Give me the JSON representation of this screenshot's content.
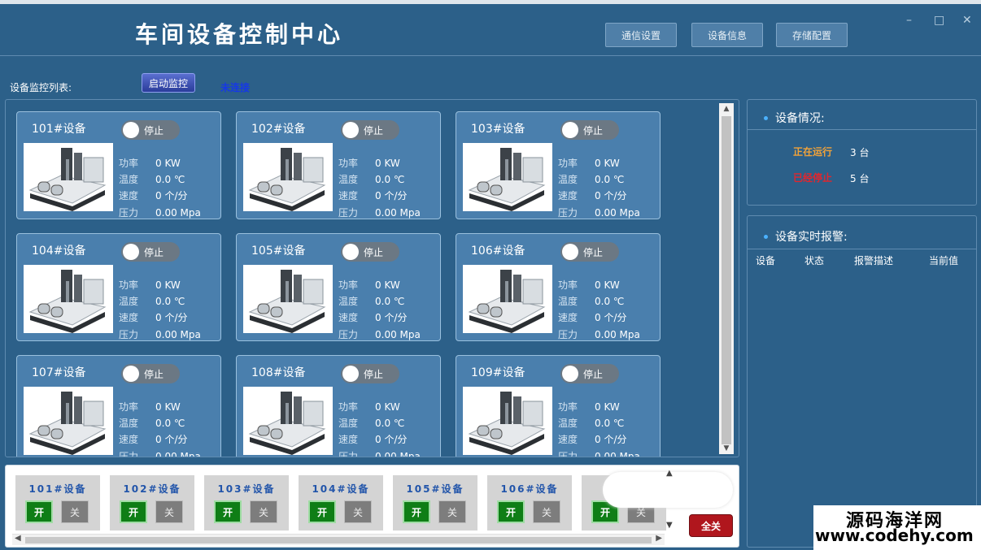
{
  "app": {
    "title": "车间设备控制中心",
    "buttons": {
      "comm": "通信设置",
      "device_info": "设备信息",
      "storage": "存储配置"
    },
    "window_controls": {
      "minimize": "–",
      "maximize": "□",
      "close": "✕"
    }
  },
  "monitor": {
    "list_label": "设备监控列表:",
    "start_button": "启动监控",
    "connection_status": "未连接"
  },
  "device_params": {
    "power": "功率",
    "temp": "温度",
    "speed": "速度",
    "pressure": "压力"
  },
  "devices": [
    {
      "name": "101#设备",
      "state": "停止",
      "power": "0 KW",
      "temp": "0.0 ℃",
      "speed": "0 个/分",
      "pressure": "0.00 Mpa"
    },
    {
      "name": "102#设备",
      "state": "停止",
      "power": "0 KW",
      "temp": "0.0 ℃",
      "speed": "0 个/分",
      "pressure": "0.00 Mpa"
    },
    {
      "name": "103#设备",
      "state": "停止",
      "power": "0 KW",
      "temp": "0.0 ℃",
      "speed": "0 个/分",
      "pressure": "0.00 Mpa"
    },
    {
      "name": "104#设备",
      "state": "停止",
      "power": "0 KW",
      "temp": "0.0 ℃",
      "speed": "0 个/分",
      "pressure": "0.00 Mpa"
    },
    {
      "name": "105#设备",
      "state": "停止",
      "power": "0 KW",
      "temp": "0.0 ℃",
      "speed": "0 个/分",
      "pressure": "0.00 Mpa"
    },
    {
      "name": "106#设备",
      "state": "停止",
      "power": "0 KW",
      "temp": "0.0 ℃",
      "speed": "0 个/分",
      "pressure": "0.00 Mpa"
    },
    {
      "name": "107#设备",
      "state": "停止",
      "power": "0 KW",
      "temp": "0.0 ℃",
      "speed": "0 个/分",
      "pressure": "0.00 Mpa"
    },
    {
      "name": "108#设备",
      "state": "停止",
      "power": "0 KW",
      "temp": "0.0 ℃",
      "speed": "0 个/分",
      "pressure": "0.00 Mpa"
    },
    {
      "name": "109#设备",
      "state": "停止",
      "power": "0 KW",
      "temp": "0.0 ℃",
      "speed": "0 个/分",
      "pressure": "0.00 Mpa"
    }
  ],
  "controls": {
    "on_label": "开",
    "off_label": "关",
    "all_off": "全关",
    "items": [
      "101#设备",
      "102#设备",
      "103#设备",
      "104#设备",
      "105#设备",
      "106#设备",
      "1"
    ]
  },
  "status_panel": {
    "title": "设备情况:",
    "running_label": "正在运行",
    "running_count": "3 台",
    "stopped_label": "已经停止",
    "stopped_count": "5 台"
  },
  "alarm_panel": {
    "title": "设备实时报警:",
    "columns": [
      "设备",
      "状态",
      "报警描述",
      "当前值"
    ]
  },
  "watermark": {
    "line1": "源码海洋网",
    "line2": "www.codehy.com"
  }
}
